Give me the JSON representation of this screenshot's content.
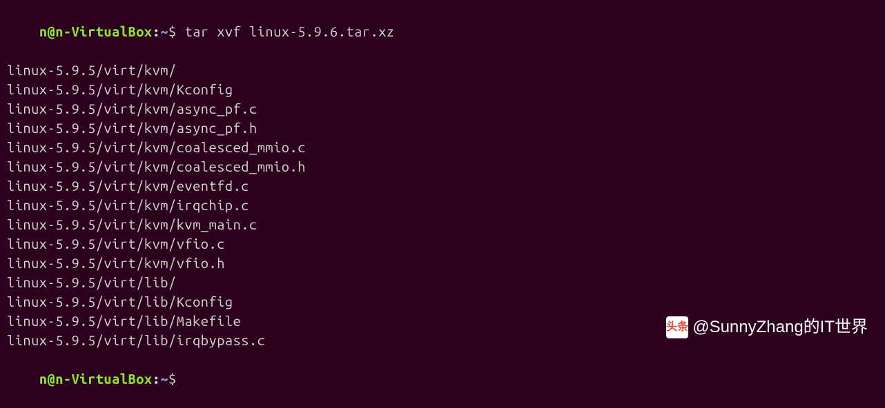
{
  "prompt": {
    "user_host": "n@n-VirtualBox",
    "separator": ":",
    "path": "~",
    "symbol": "$"
  },
  "command": "tar xvf linux-5.9.6.tar.xz",
  "output_lines": [
    "linux-5.9.5/virt/kvm/",
    "linux-5.9.5/virt/kvm/Kconfig",
    "linux-5.9.5/virt/kvm/async_pf.c",
    "linux-5.9.5/virt/kvm/async_pf.h",
    "linux-5.9.5/virt/kvm/coalesced_mmio.c",
    "linux-5.9.5/virt/kvm/coalesced_mmio.h",
    "linux-5.9.5/virt/kvm/eventfd.c",
    "linux-5.9.5/virt/kvm/irqchip.c",
    "linux-5.9.5/virt/kvm/kvm_main.c",
    "linux-5.9.5/virt/kvm/vfio.c",
    "linux-5.9.5/virt/kvm/vfio.h",
    "linux-5.9.5/virt/lib/",
    "linux-5.9.5/virt/lib/Kconfig",
    "linux-5.9.5/virt/lib/Makefile",
    "linux-5.9.5/virt/lib/irqbypass.c"
  ],
  "watermark": {
    "icon_text": "头条",
    "text": "@SunnyZhang的IT世界"
  }
}
